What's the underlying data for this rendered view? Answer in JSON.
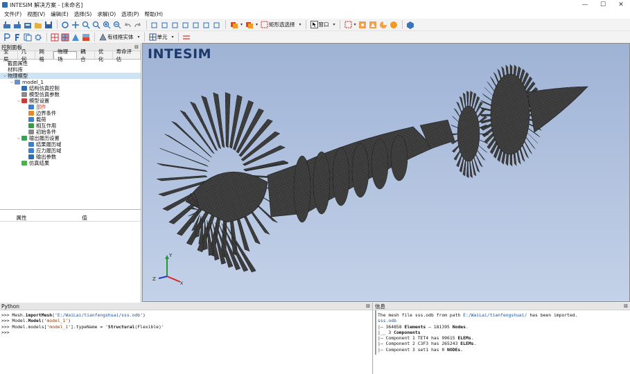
{
  "window": {
    "title": "INTESIM 解决方案 - [未命名]",
    "controls": [
      "—",
      "☐",
      "✕"
    ]
  },
  "menu": [
    "文件(F)",
    "视图(V)",
    "编辑(E)",
    "选择(S)",
    "求解(O)",
    "选项(P)",
    "帮助(H)"
  ],
  "toolbar": {
    "select_mode": "矩形选选择",
    "window_label": "窗口",
    "solid_mode": "有线框实体",
    "unit_label": "单元"
  },
  "left_panel": {
    "title": "控制面板",
    "tabs": [
      "全局",
      "几何",
      "网格",
      "物理场",
      "耦合",
      "优化",
      "寿命评估"
    ],
    "active_tab": 3,
    "tree": [
      {
        "label": "截面属性",
        "level": 0,
        "arrow": "",
        "icon": ""
      },
      {
        "label": "材料库",
        "level": 0,
        "arrow": "",
        "icon": ""
      },
      {
        "label": "物理模型",
        "level": 0,
        "arrow": "⌵",
        "icon": "",
        "selected": true
      },
      {
        "label": "model_1",
        "level": 1,
        "arrow": "⌵",
        "icon": "model"
      },
      {
        "label": "结构仿真控制",
        "level": 2,
        "arrow": "",
        "icon": "control"
      },
      {
        "label": "模型仿真参数",
        "level": 2,
        "arrow": "",
        "icon": "params"
      },
      {
        "label": "模型设置",
        "level": 2,
        "arrow": "⌵",
        "icon": "setup"
      },
      {
        "label": "部件",
        "level": 3,
        "arrow": "",
        "icon": "part"
      },
      {
        "label": "边界条件",
        "level": 3,
        "arrow": "",
        "icon": "bc"
      },
      {
        "label": "载荷",
        "level": 3,
        "arrow": "",
        "icon": "load"
      },
      {
        "label": "相互作用",
        "level": 3,
        "arrow": "",
        "icon": "interact"
      },
      {
        "label": "初始条件",
        "level": 3,
        "arrow": "",
        "icon": "init"
      },
      {
        "label": "输出履历设置",
        "level": 2,
        "arrow": "⌵",
        "icon": "output"
      },
      {
        "label": "结果履历域",
        "level": 3,
        "arrow": "",
        "icon": "history"
      },
      {
        "label": "应力履历域",
        "level": 3,
        "arrow": "",
        "icon": "history"
      },
      {
        "label": "输出参数",
        "level": 3,
        "arrow": "",
        "icon": "param"
      },
      {
        "label": "仿真结果",
        "level": 2,
        "arrow": "",
        "icon": "result"
      }
    ],
    "props_cols": [
      "属性",
      "值"
    ]
  },
  "viewport": {
    "brand": "INTESIM",
    "axes": {
      "y": "Y",
      "z": "Z",
      "x": "X"
    }
  },
  "python_panel": {
    "title": "Python",
    "lines": [
      [
        {
          "t": ">>> Mesh."
        },
        {
          "t": "importMesh",
          "b": true
        },
        {
          "t": "('"
        },
        {
          "t": "E:/WaiLai/tianfengshuai/sss.odb",
          "c": "path"
        },
        {
          "t": "')"
        }
      ],
      [
        {
          "t": ">>> Model."
        },
        {
          "t": "Model",
          "b": true
        },
        {
          "t": "('"
        },
        {
          "t": "model_1",
          "c": "str"
        },
        {
          "t": "')"
        }
      ],
      [
        {
          "t": ">>> Model.models['"
        },
        {
          "t": "model_1",
          "c": "str"
        },
        {
          "t": "'].typeName = '"
        },
        {
          "t": "Structural",
          "b": true
        },
        {
          "t": "(Flexible)'"
        }
      ],
      [
        {
          "t": ">>>"
        }
      ]
    ]
  },
  "info_panel": {
    "title": "信息",
    "lines": [
      [
        {
          "t": "The mesh file sss.odb from path "
        },
        {
          "t": "E:/WaiLai/tianfengshuai/",
          "c": "path"
        },
        {
          "t": " has been imported."
        }
      ],
      [
        {
          "t": "sss.odb",
          "c": "path"
        }
      ],
      [
        {
          "t": "|— 364858 "
        },
        {
          "t": "Elements",
          "b": true
        },
        {
          "t": " — 181395 "
        },
        {
          "t": "Nodes",
          "b": true
        },
        {
          "t": "."
        }
      ],
      [
        {
          "t": "|__ 3 "
        },
        {
          "t": "Components",
          "b": true
        }
      ],
      [
        {
          "t": "   |— Component 1 TET4 has 99615 "
        },
        {
          "t": "ELEMs",
          "b": true
        },
        {
          "t": "."
        }
      ],
      [
        {
          "t": "   |— Component 2 C3F3 has 265243 "
        },
        {
          "t": "ELEMs",
          "b": true
        },
        {
          "t": "."
        }
      ],
      [
        {
          "t": "   |— Component 3 set1 has 0 "
        },
        {
          "t": "NODEs",
          "b": true
        },
        {
          "t": "."
        }
      ]
    ]
  },
  "colors": {
    "viewport_top": "#9fb3d6",
    "viewport_bottom": "#c4d2e8",
    "brand": "#1d3a6a",
    "selection": "#cde4f7",
    "mesh": "#1a1a1a"
  }
}
